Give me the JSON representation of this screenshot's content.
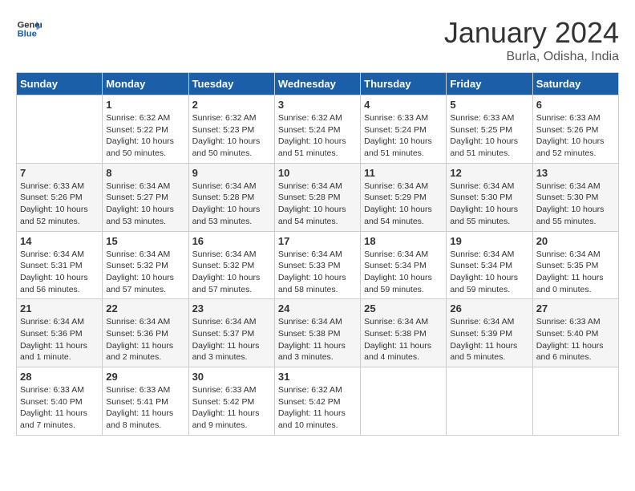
{
  "header": {
    "logo_line1": "General",
    "logo_line2": "Blue",
    "month_title": "January 2024",
    "subtitle": "Burla, Odisha, India"
  },
  "columns": [
    "Sunday",
    "Monday",
    "Tuesday",
    "Wednesday",
    "Thursday",
    "Friday",
    "Saturday"
  ],
  "weeks": [
    [
      {
        "day": "",
        "info": ""
      },
      {
        "day": "1",
        "info": "Sunrise: 6:32 AM\nSunset: 5:22 PM\nDaylight: 10 hours\nand 50 minutes."
      },
      {
        "day": "2",
        "info": "Sunrise: 6:32 AM\nSunset: 5:23 PM\nDaylight: 10 hours\nand 50 minutes."
      },
      {
        "day": "3",
        "info": "Sunrise: 6:32 AM\nSunset: 5:24 PM\nDaylight: 10 hours\nand 51 minutes."
      },
      {
        "day": "4",
        "info": "Sunrise: 6:33 AM\nSunset: 5:24 PM\nDaylight: 10 hours\nand 51 minutes."
      },
      {
        "day": "5",
        "info": "Sunrise: 6:33 AM\nSunset: 5:25 PM\nDaylight: 10 hours\nand 51 minutes."
      },
      {
        "day": "6",
        "info": "Sunrise: 6:33 AM\nSunset: 5:26 PM\nDaylight: 10 hours\nand 52 minutes."
      }
    ],
    [
      {
        "day": "7",
        "info": "Sunrise: 6:33 AM\nSunset: 5:26 PM\nDaylight: 10 hours\nand 52 minutes."
      },
      {
        "day": "8",
        "info": "Sunrise: 6:34 AM\nSunset: 5:27 PM\nDaylight: 10 hours\nand 53 minutes."
      },
      {
        "day": "9",
        "info": "Sunrise: 6:34 AM\nSunset: 5:28 PM\nDaylight: 10 hours\nand 53 minutes."
      },
      {
        "day": "10",
        "info": "Sunrise: 6:34 AM\nSunset: 5:28 PM\nDaylight: 10 hours\nand 54 minutes."
      },
      {
        "day": "11",
        "info": "Sunrise: 6:34 AM\nSunset: 5:29 PM\nDaylight: 10 hours\nand 54 minutes."
      },
      {
        "day": "12",
        "info": "Sunrise: 6:34 AM\nSunset: 5:30 PM\nDaylight: 10 hours\nand 55 minutes."
      },
      {
        "day": "13",
        "info": "Sunrise: 6:34 AM\nSunset: 5:30 PM\nDaylight: 10 hours\nand 55 minutes."
      }
    ],
    [
      {
        "day": "14",
        "info": "Sunrise: 6:34 AM\nSunset: 5:31 PM\nDaylight: 10 hours\nand 56 minutes."
      },
      {
        "day": "15",
        "info": "Sunrise: 6:34 AM\nSunset: 5:32 PM\nDaylight: 10 hours\nand 57 minutes."
      },
      {
        "day": "16",
        "info": "Sunrise: 6:34 AM\nSunset: 5:32 PM\nDaylight: 10 hours\nand 57 minutes."
      },
      {
        "day": "17",
        "info": "Sunrise: 6:34 AM\nSunset: 5:33 PM\nDaylight: 10 hours\nand 58 minutes."
      },
      {
        "day": "18",
        "info": "Sunrise: 6:34 AM\nSunset: 5:34 PM\nDaylight: 10 hours\nand 59 minutes."
      },
      {
        "day": "19",
        "info": "Sunrise: 6:34 AM\nSunset: 5:34 PM\nDaylight: 10 hours\nand 59 minutes."
      },
      {
        "day": "20",
        "info": "Sunrise: 6:34 AM\nSunset: 5:35 PM\nDaylight: 11 hours\nand 0 minutes."
      }
    ],
    [
      {
        "day": "21",
        "info": "Sunrise: 6:34 AM\nSunset: 5:36 PM\nDaylight: 11 hours\nand 1 minute."
      },
      {
        "day": "22",
        "info": "Sunrise: 6:34 AM\nSunset: 5:36 PM\nDaylight: 11 hours\nand 2 minutes."
      },
      {
        "day": "23",
        "info": "Sunrise: 6:34 AM\nSunset: 5:37 PM\nDaylight: 11 hours\nand 3 minutes."
      },
      {
        "day": "24",
        "info": "Sunrise: 6:34 AM\nSunset: 5:38 PM\nDaylight: 11 hours\nand 3 minutes."
      },
      {
        "day": "25",
        "info": "Sunrise: 6:34 AM\nSunset: 5:38 PM\nDaylight: 11 hours\nand 4 minutes."
      },
      {
        "day": "26",
        "info": "Sunrise: 6:34 AM\nSunset: 5:39 PM\nDaylight: 11 hours\nand 5 minutes."
      },
      {
        "day": "27",
        "info": "Sunrise: 6:33 AM\nSunset: 5:40 PM\nDaylight: 11 hours\nand 6 minutes."
      }
    ],
    [
      {
        "day": "28",
        "info": "Sunrise: 6:33 AM\nSunset: 5:40 PM\nDaylight: 11 hours\nand 7 minutes."
      },
      {
        "day": "29",
        "info": "Sunrise: 6:33 AM\nSunset: 5:41 PM\nDaylight: 11 hours\nand 8 minutes."
      },
      {
        "day": "30",
        "info": "Sunrise: 6:33 AM\nSunset: 5:42 PM\nDaylight: 11 hours\nand 9 minutes."
      },
      {
        "day": "31",
        "info": "Sunrise: 6:32 AM\nSunset: 5:42 PM\nDaylight: 11 hours\nand 10 minutes."
      },
      {
        "day": "",
        "info": ""
      },
      {
        "day": "",
        "info": ""
      },
      {
        "day": "",
        "info": ""
      }
    ]
  ]
}
